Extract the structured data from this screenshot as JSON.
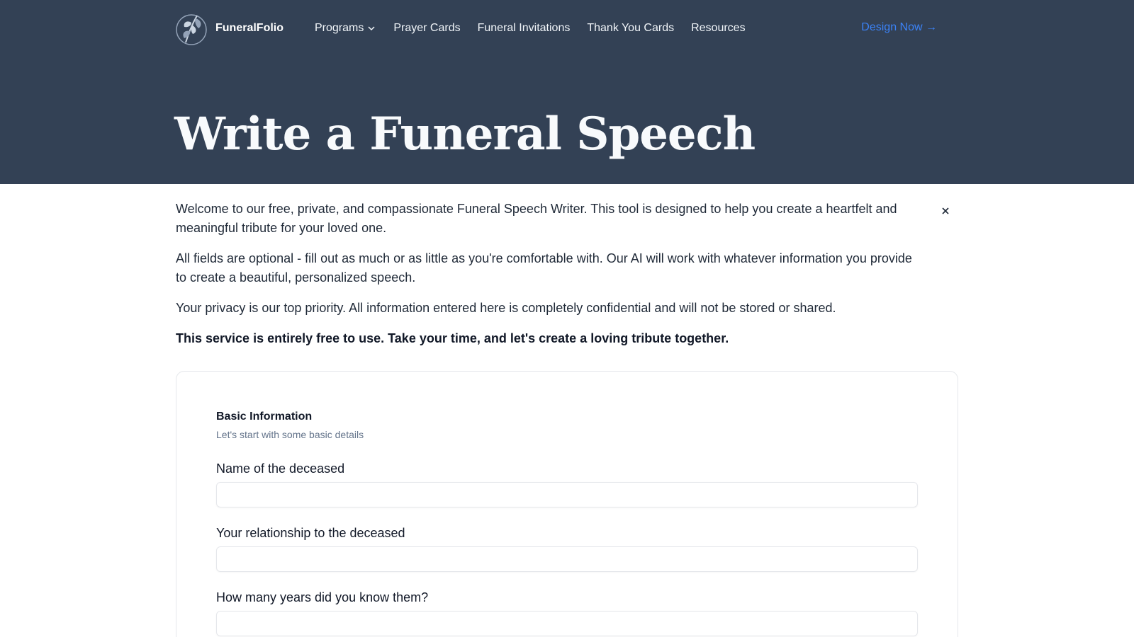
{
  "nav": {
    "brand_name": "FuneralFolio",
    "links": [
      {
        "label": "Programs",
        "has_dropdown": true
      },
      {
        "label": "Prayer Cards"
      },
      {
        "label": "Funeral Invitations"
      },
      {
        "label": "Thank You Cards"
      },
      {
        "label": "Resources"
      }
    ],
    "cta_label": "Design Now →"
  },
  "hero": {
    "title": "Write a Funeral Speech"
  },
  "intro": {
    "paragraphs": [
      "Welcome to our free, private, and compassionate Funeral Speech Writer. This tool is designed to help you create a heartfelt and meaningful tribute for your loved one.",
      "All fields are optional - fill out as much or as little as you're comfortable with. Our AI will work with whatever information you provide to create a beautiful, personalized speech.",
      "Your privacy is our top priority. All information entered here is completely confidential and will not be stored or shared."
    ],
    "bold_note": "This service is entirely free to use. Take your time, and let's create a loving tribute together."
  },
  "form": {
    "section_title": "Basic Information",
    "section_subtitle": "Let's start with some basic details",
    "fields": [
      {
        "label": "Name of the deceased",
        "value": ""
      },
      {
        "label": "Your relationship to the deceased",
        "value": ""
      },
      {
        "label": "How many years did you know them?",
        "value": ""
      }
    ]
  },
  "colors": {
    "hero_bg": "#334155",
    "accent": "#3b82f6"
  }
}
